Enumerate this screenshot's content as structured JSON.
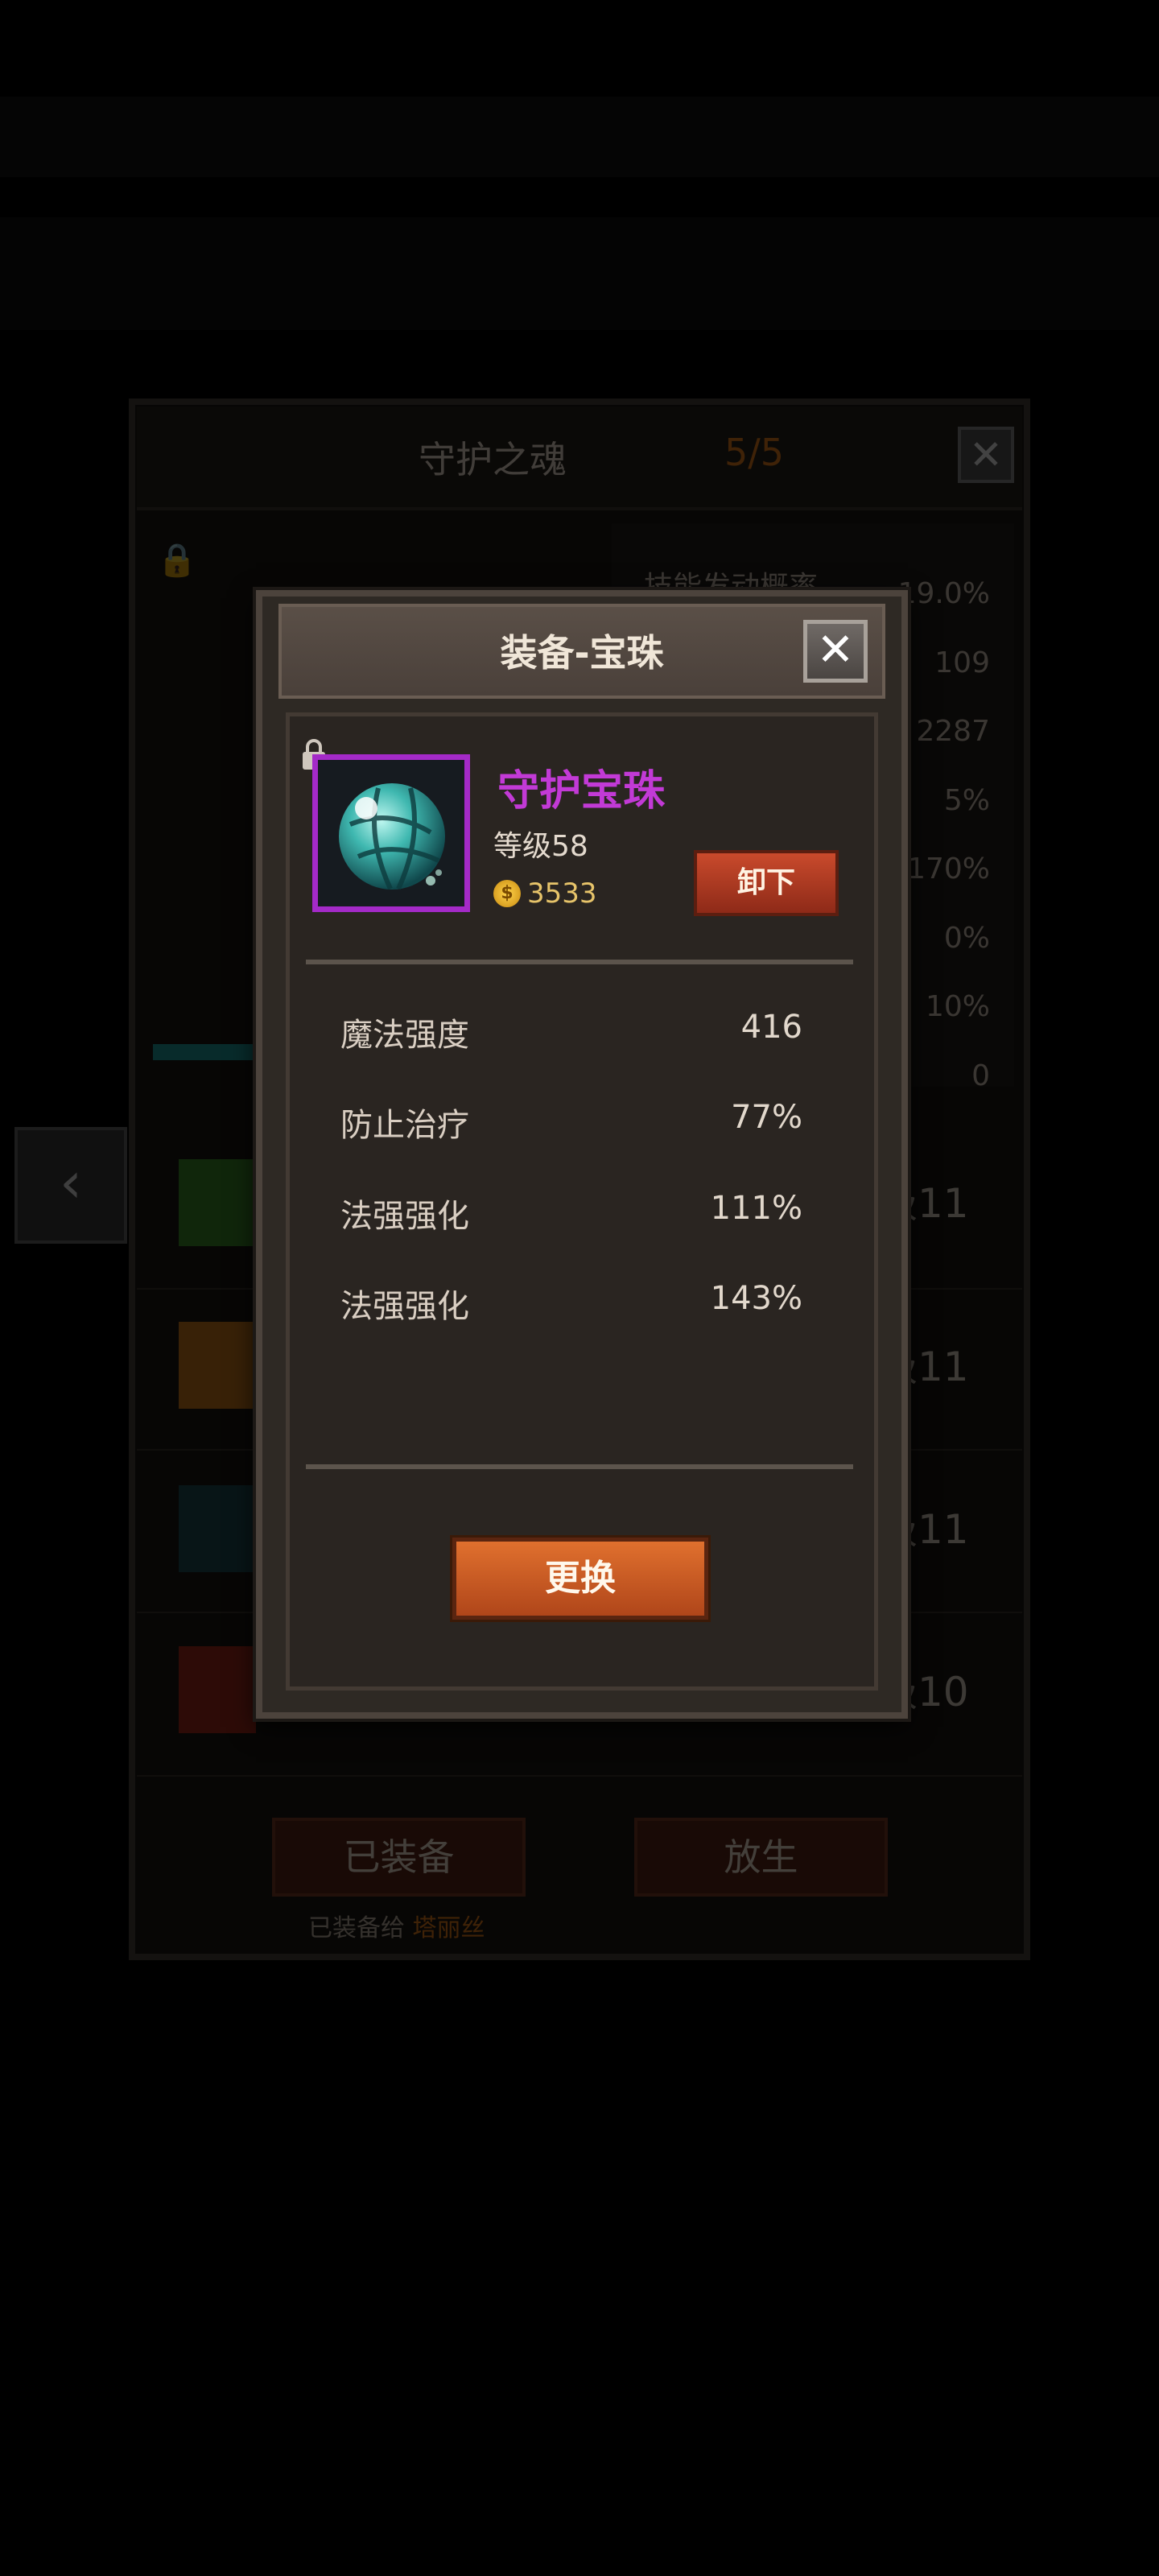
{
  "background": {
    "window_title": "守护之魂",
    "window_count": "5/5",
    "close_symbol": "✕",
    "stat_values": [
      "19.0%",
      "109",
      "2287",
      "5%",
      "170%",
      "0%",
      "10%",
      "0"
    ],
    "stat_label_first": "技能发动概率",
    "skill_levels": [
      "级11",
      "级11",
      "级11",
      "级10"
    ],
    "equipped_button": "已装备",
    "release_button": "放生",
    "equipped_to_prefix": "已装备给",
    "equipped_to_name": "塔丽丝",
    "left_arrow": "‹"
  },
  "modal": {
    "title": "装备-宝珠",
    "close_symbol": "✕",
    "item_name": "守护宝珠",
    "item_level": "等级58",
    "item_price": "3533",
    "unequip_button": "卸下",
    "stats": [
      {
        "name": "魔法强度",
        "value": "416"
      },
      {
        "name": "防止治疗",
        "value": "77%"
      },
      {
        "name": "法强强化",
        "value": "111%"
      },
      {
        "name": "法强强化",
        "value": "143%"
      }
    ],
    "replace_button": "更换"
  },
  "icons": {
    "lock": "lock-icon",
    "coin": "gold-coin-icon",
    "orb": "teal-orb-icon"
  },
  "colors": {
    "item_name": "#c23ad6",
    "frame_purple": "#a42ac8",
    "button_orange": "#c9602a",
    "button_red": "#b0391f",
    "count_orange": "#e07a1a"
  }
}
